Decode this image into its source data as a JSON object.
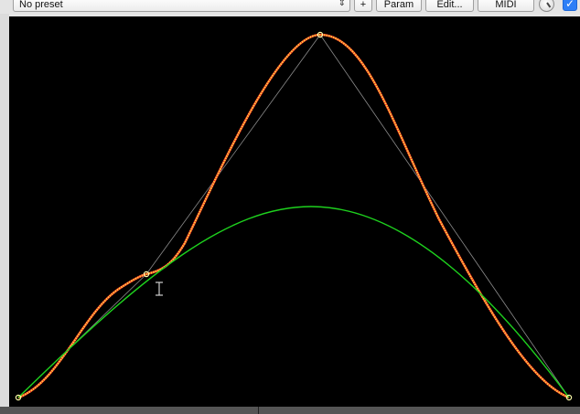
{
  "toolbar": {
    "preset_value": "No preset",
    "add_label": "+",
    "param_label": "Param",
    "edit_label": "Edit...",
    "midi_label": "MIDI",
    "enabled": true
  },
  "colors": {
    "background": "#000000",
    "control_lines": "#8c8c8c",
    "bezier_curve": "#ffd23a",
    "curve_outline": "#ff2a2a",
    "fit_curve": "#1ed21e",
    "points": "#ffffaa"
  },
  "icons": {
    "preset_chevron": "chevron-updown-icon",
    "knob": "knob-icon",
    "checkbox": "checkmark-icon",
    "cursor": "text-cursor-icon"
  }
}
